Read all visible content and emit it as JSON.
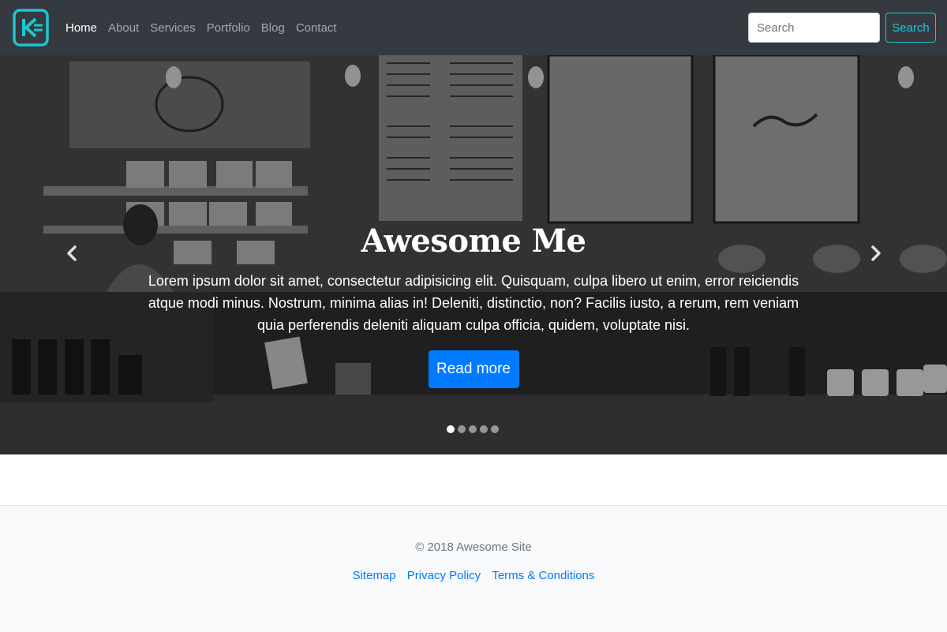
{
  "navbar": {
    "brand_icon": "k-logo-icon",
    "links": [
      {
        "label": "Home",
        "active": true
      },
      {
        "label": "About"
      },
      {
        "label": "Services"
      },
      {
        "label": "Portfolio"
      },
      {
        "label": "Blog"
      },
      {
        "label": "Contact"
      }
    ],
    "search": {
      "placeholder": "Search",
      "value": "",
      "button_label": "Search"
    }
  },
  "hero": {
    "title": "Awesome Me",
    "text": "Lorem ipsum dolor sit amet, consectetur adipisicing elit. Quisquam, culpa libero ut enim, error reiciendis atque modi minus. Nostrum, minima alias in! Deleniti, distinctio, non? Facilis iusto, a rerum, rem veniam quia perferendis deleniti aliquam culpa officia, quidem, voluptate nisi.",
    "button_label": "Read more",
    "slides_total": 5,
    "active_slide": 1
  },
  "footer": {
    "copyright": "© 2018 Awesome Site",
    "links": [
      "Sitemap",
      "Privacy Policy",
      "Terms & Conditions"
    ]
  },
  "colors": {
    "navbar_bg": "#343a40",
    "accent": "#1cc7d0",
    "primary": "#007bff",
    "footer_bg": "#f8f9fa"
  }
}
